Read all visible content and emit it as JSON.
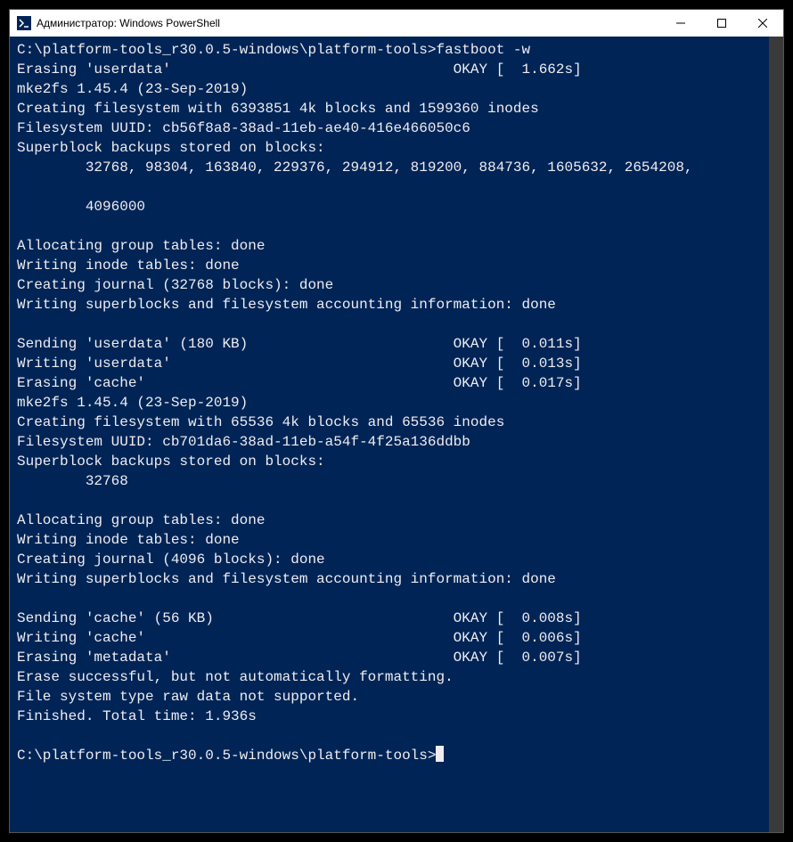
{
  "titlebar": {
    "title": "Администратор: Windows PowerShell"
  },
  "terminal": {
    "prompt1": "C:\\platform-tools_r30.0.5-windows\\platform-tools>",
    "command1": "fastboot -w",
    "lines": [
      "Erasing 'userdata'                                 OKAY [  1.662s]",
      "mke2fs 1.45.4 (23-Sep-2019)",
      "Creating filesystem with 6393851 4k blocks and 1599360 inodes",
      "Filesystem UUID: cb56f8a8-38ad-11eb-ae40-416e466050c6",
      "Superblock backups stored on blocks:",
      "        32768, 98304, 163840, 229376, 294912, 819200, 884736, 1605632, 2654208,",
      "",
      "        4096000",
      "",
      "Allocating group tables: done",
      "Writing inode tables: done",
      "Creating journal (32768 blocks): done",
      "Writing superblocks and filesystem accounting information: done",
      "",
      "Sending 'userdata' (180 KB)                        OKAY [  0.011s]",
      "Writing 'userdata'                                 OKAY [  0.013s]",
      "Erasing 'cache'                                    OKAY [  0.017s]",
      "mke2fs 1.45.4 (23-Sep-2019)",
      "Creating filesystem with 65536 4k blocks and 65536 inodes",
      "Filesystem UUID: cb701da6-38ad-11eb-a54f-4f25a136ddbb",
      "Superblock backups stored on blocks:",
      "        32768",
      "",
      "Allocating group tables: done",
      "Writing inode tables: done",
      "Creating journal (4096 blocks): done",
      "Writing superblocks and filesystem accounting information: done",
      "",
      "Sending 'cache' (56 KB)                            OKAY [  0.008s]",
      "Writing 'cache'                                    OKAY [  0.006s]",
      "Erasing 'metadata'                                 OKAY [  0.007s]",
      "Erase successful, but not automatically formatting.",
      "File system type raw data not supported.",
      "Finished. Total time: 1.936s",
      ""
    ],
    "prompt2": "C:\\platform-tools_r30.0.5-windows\\platform-tools>"
  }
}
